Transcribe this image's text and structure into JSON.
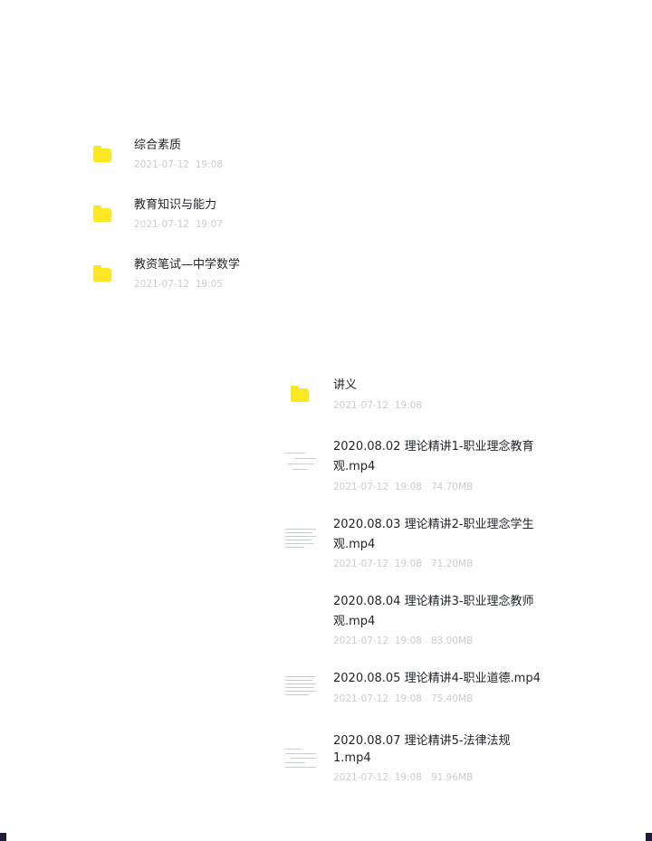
{
  "top_list": [
    {
      "name": "综合素质",
      "date": "2021-07-12  19:08"
    },
    {
      "name": "教育知识与能力",
      "date": "2021-07-12  19:07"
    },
    {
      "name": "教资笔试—中学数学",
      "date": "2021-07-12  19:05"
    }
  ],
  "bottom_list": {
    "folder": {
      "name": "讲义",
      "date": "2021-07-12  19:08"
    },
    "files": [
      {
        "line1": "2020.08.02 理论精讲1-职业理念教育",
        "line2": "观.mp4",
        "meta": "2021-07-12  19:08   74.70MB"
      },
      {
        "line1": "2020.08.03 理论精讲2-职业理念学生",
        "line2": "观.mp4",
        "meta": "2021-07-12  19:08   71.20MB"
      },
      {
        "line1": "2020.08.04 理论精讲3-职业理念教师",
        "line2": "观.mp4",
        "meta": "2021-07-12  19:08   83.00MB"
      },
      {
        "line1": "2020.08.05 理论精讲4-职业道德.mp4",
        "line2": "",
        "meta": "2021-07-12  19:08   75.40MB"
      },
      {
        "line1": "2020.08.07 理论精讲5-法律法规",
        "line2": "1.mp4",
        "meta": "2021-07-12  19:08   91.96MB"
      }
    ]
  },
  "icons": {
    "folder": "folder-icon",
    "video": "video-thumbnail"
  },
  "colors": {
    "folder": "#fbe822",
    "title": "#1f2329",
    "meta": "#c9ccd1",
    "corner": "#1d1e3a"
  }
}
